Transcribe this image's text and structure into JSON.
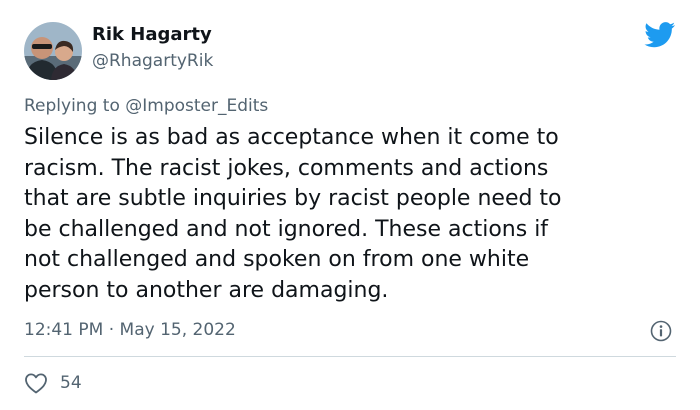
{
  "author": {
    "name": "Rik Hagarty",
    "handle": "@RhagartyRik",
    "avatar_icon": "avatar-photo"
  },
  "reply": {
    "prefix": "Replying to ",
    "target": "@Imposter_Edits"
  },
  "body": "Silence is as bad as acceptance when it come to\nracism.  The racist jokes, comments and actions\nthat are subtle inquiries by racist people need to\nbe challenged and not ignored.  These actions if\nnot challenged and spoken on from one white\nperson to another are damaging.",
  "meta": {
    "timestamp": "12:41 PM · May 15, 2022"
  },
  "engagement": {
    "likes": "54"
  },
  "icons": {
    "brand": "twitter-bird-icon",
    "info": "info-icon",
    "like": "heart-icon"
  },
  "colors": {
    "brand_blue": "#1d9bf0",
    "secondary_text": "#536471",
    "primary_text": "#0f1419",
    "divider": "#cfd9de"
  }
}
